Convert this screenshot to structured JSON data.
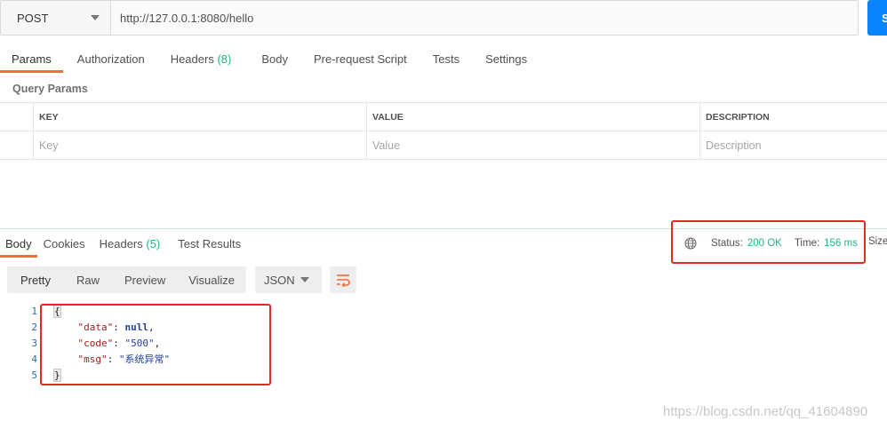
{
  "request": {
    "method": "POST",
    "url": "http://127.0.0.1:8080/hello",
    "send_label": "S"
  },
  "request_tabs": [
    {
      "label": "Params",
      "active": true
    },
    {
      "label": "Authorization"
    },
    {
      "label": "Headers",
      "count": "(8)"
    },
    {
      "label": "Body"
    },
    {
      "label": "Pre-request Script"
    },
    {
      "label": "Tests"
    },
    {
      "label": "Settings"
    }
  ],
  "query_params": {
    "title": "Query Params",
    "columns": [
      "KEY",
      "VALUE",
      "DESCRIPTION"
    ],
    "placeholders": [
      "Key",
      "Value",
      "Description"
    ]
  },
  "response_tabs": [
    {
      "label": "Body",
      "active": true
    },
    {
      "label": "Cookies"
    },
    {
      "label": "Headers",
      "count": "(5)"
    },
    {
      "label": "Test Results"
    }
  ],
  "status": {
    "status_label": "Status:",
    "status_value": "200 OK",
    "time_label": "Time:",
    "time_value": "156 ms",
    "size_label": "Size"
  },
  "format": {
    "buttons": [
      "Pretty",
      "Raw",
      "Preview",
      "Visualize"
    ],
    "language": "JSON"
  },
  "code": {
    "line_numbers": [
      "1",
      "2",
      "3",
      "4",
      "5"
    ],
    "open_brace": "{",
    "close_brace": "}",
    "data_key": "\"data\"",
    "data_value": "null",
    "code_key": "\"code\"",
    "code_value": "\"500\"",
    "msg_key": "\"msg\"",
    "msg_value": "\"系统异常\""
  },
  "watermark": "https://blog.csdn.net/qq_41604890",
  "colors": {
    "accent": "#f26b3a",
    "success": "#26b47f",
    "highlight_box": "#e22b20",
    "send_button": "#0a84ff"
  }
}
